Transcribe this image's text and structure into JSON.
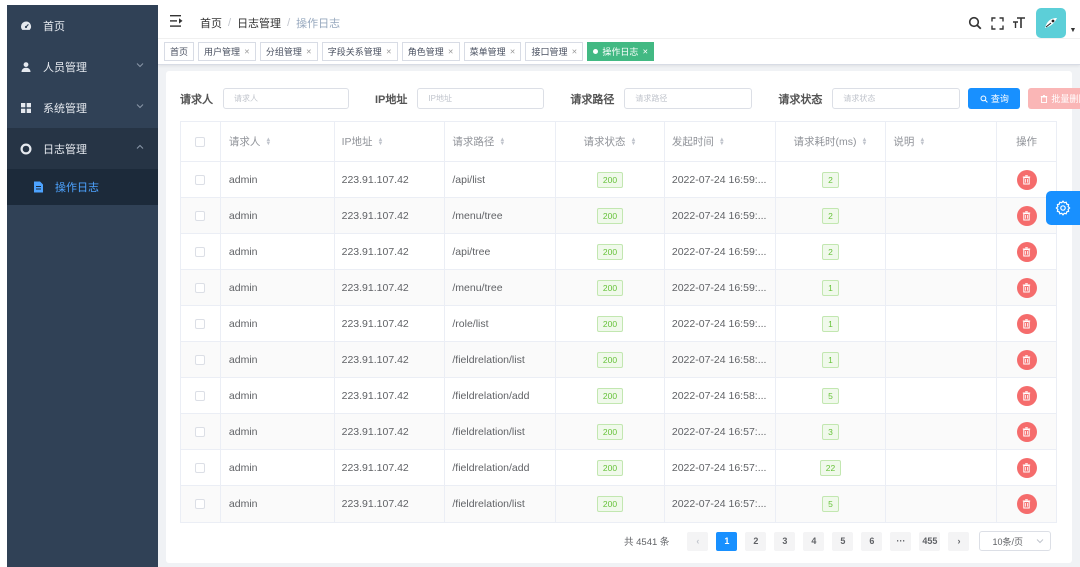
{
  "sidebar": {
    "items": [
      {
        "label": "首页",
        "icon": "dashboard-icon"
      },
      {
        "label": "人员管理",
        "icon": "user-icon"
      },
      {
        "label": "系统管理",
        "icon": "grid-icon"
      },
      {
        "label": "日志管理",
        "icon": "log-icon"
      }
    ],
    "sub_items": [
      {
        "label": "操作日志",
        "icon": "document-icon"
      }
    ]
  },
  "breadcrumb": [
    "首页",
    "日志管理",
    "操作日志"
  ],
  "tags": [
    {
      "label": "首页"
    },
    {
      "label": "用户管理"
    },
    {
      "label": "分组管理"
    },
    {
      "label": "字段关系管理"
    },
    {
      "label": "角色管理"
    },
    {
      "label": "菜单管理"
    },
    {
      "label": "接口管理"
    },
    {
      "label": "操作日志"
    }
  ],
  "filters": {
    "requester_label": "请求人",
    "requester_placeholder": "请求人",
    "ip_label": "IP地址",
    "ip_placeholder": "IP地址",
    "path_label": "请求路径",
    "path_placeholder": "请求路径",
    "status_label": "请求状态",
    "status_placeholder": "请求状态",
    "query_button": "查询",
    "batch_delete_button": "批量删除"
  },
  "table": {
    "headers": [
      "请求人",
      "IP地址",
      "请求路径",
      "请求状态",
      "发起时间",
      "请求耗时(ms)",
      "说明",
      "操作"
    ],
    "rows": [
      {
        "requester": "admin",
        "ip": "223.91.107.42",
        "path": "/api/list",
        "status": "200",
        "time": "2022-07-24 16:59:...",
        "cost": "2",
        "note": ""
      },
      {
        "requester": "admin",
        "ip": "223.91.107.42",
        "path": "/menu/tree",
        "status": "200",
        "time": "2022-07-24 16:59:...",
        "cost": "2",
        "note": ""
      },
      {
        "requester": "admin",
        "ip": "223.91.107.42",
        "path": "/api/tree",
        "status": "200",
        "time": "2022-07-24 16:59:...",
        "cost": "2",
        "note": ""
      },
      {
        "requester": "admin",
        "ip": "223.91.107.42",
        "path": "/menu/tree",
        "status": "200",
        "time": "2022-07-24 16:59:...",
        "cost": "1",
        "note": ""
      },
      {
        "requester": "admin",
        "ip": "223.91.107.42",
        "path": "/role/list",
        "status": "200",
        "time": "2022-07-24 16:59:...",
        "cost": "1",
        "note": ""
      },
      {
        "requester": "admin",
        "ip": "223.91.107.42",
        "path": "/fieldrelation/list",
        "status": "200",
        "time": "2022-07-24 16:58:...",
        "cost": "1",
        "note": ""
      },
      {
        "requester": "admin",
        "ip": "223.91.107.42",
        "path": "/fieldrelation/add",
        "status": "200",
        "time": "2022-07-24 16:58:...",
        "cost": "5",
        "note": ""
      },
      {
        "requester": "admin",
        "ip": "223.91.107.42",
        "path": "/fieldrelation/list",
        "status": "200",
        "time": "2022-07-24 16:57:...",
        "cost": "3",
        "note": ""
      },
      {
        "requester": "admin",
        "ip": "223.91.107.42",
        "path": "/fieldrelation/add",
        "status": "200",
        "time": "2022-07-24 16:57:...",
        "cost": "22",
        "note": ""
      },
      {
        "requester": "admin",
        "ip": "223.91.107.42",
        "path": "/fieldrelation/list",
        "status": "200",
        "time": "2022-07-24 16:57:...",
        "cost": "5",
        "note": ""
      }
    ]
  },
  "pagination": {
    "total_text": "共 4541 条",
    "pages": [
      "1",
      "2",
      "3",
      "4",
      "5",
      "6",
      "···",
      "455"
    ],
    "current": "1",
    "page_size": "10条/页"
  },
  "colors": {
    "sidebar_bg": "#304156",
    "primary": "#1890ff",
    "active_tag": "#42b983",
    "danger": "#f56c6c",
    "success": "#67c23a"
  }
}
